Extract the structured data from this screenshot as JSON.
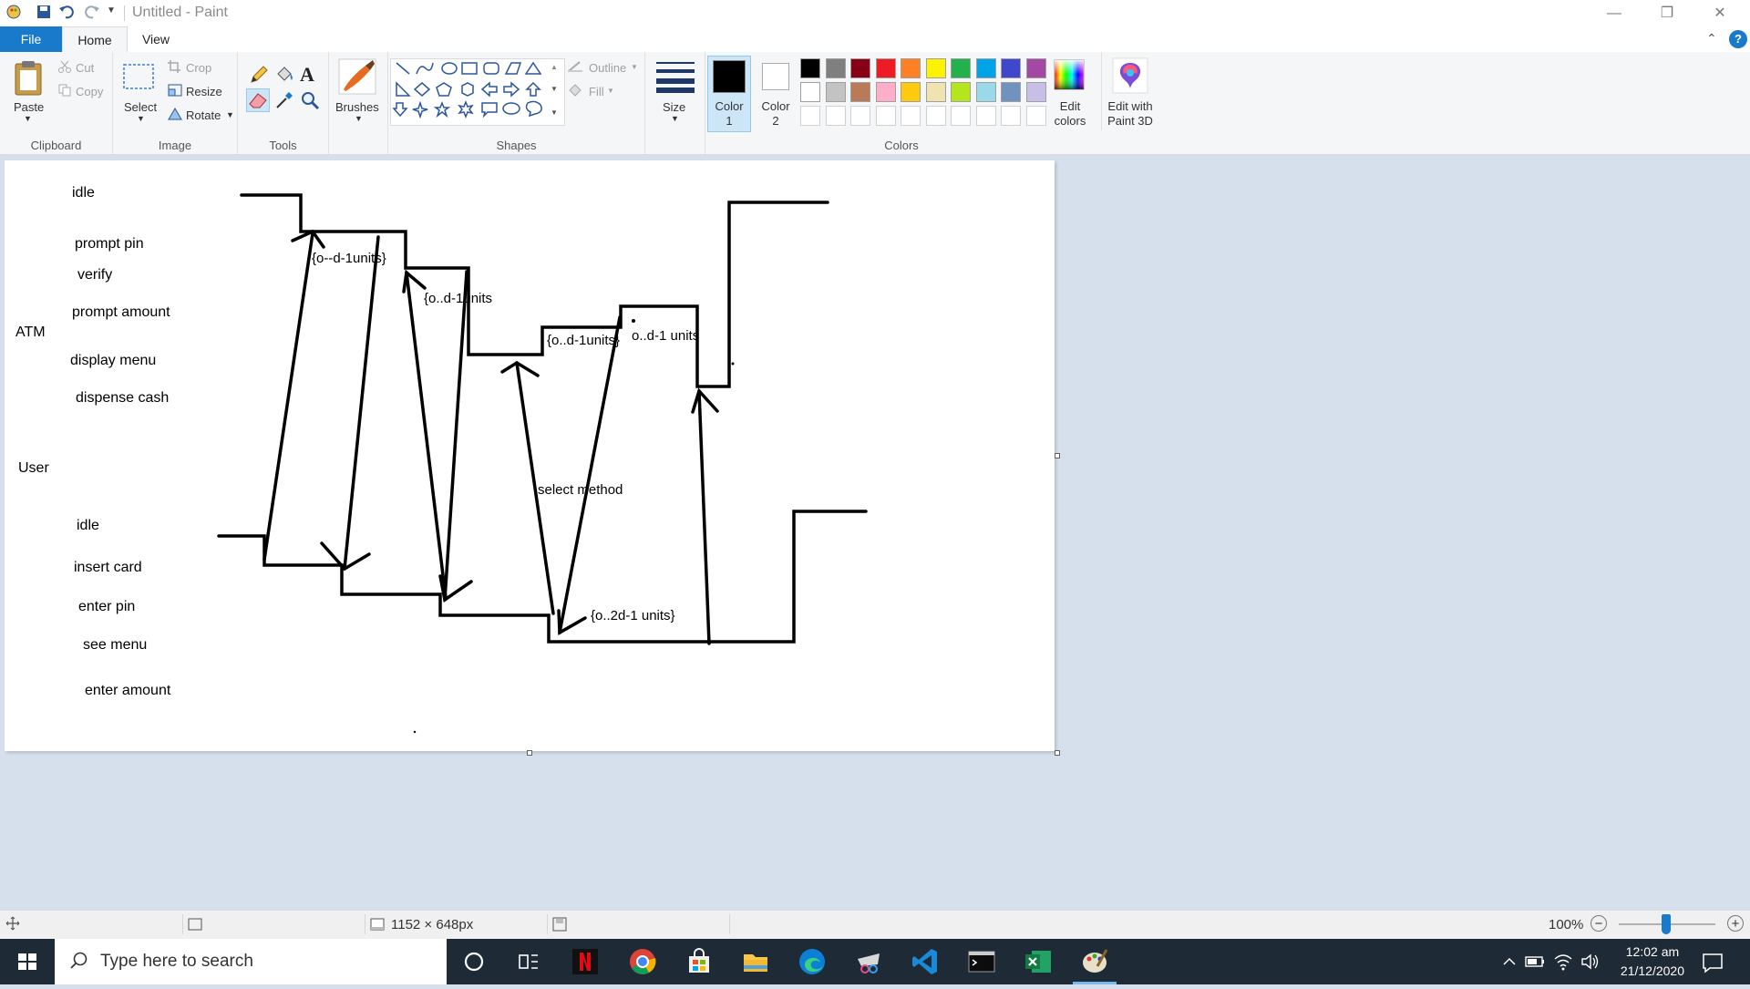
{
  "window": {
    "title": "Untitled - Paint",
    "controls": [
      "—",
      "❐",
      "✕"
    ]
  },
  "tabs": [
    {
      "label": "File"
    },
    {
      "label": "Home"
    },
    {
      "label": "View"
    }
  ],
  "ribbon": {
    "clipboard": {
      "group": "Clipboard",
      "paste": "Paste",
      "cut": "Cut",
      "copy": "Copy"
    },
    "image": {
      "group": "Image",
      "select": "Select",
      "crop": "Crop",
      "resize": "Resize",
      "rotate": "Rotate"
    },
    "tools": {
      "group": "Tools"
    },
    "brushes": {
      "label": "Brushes"
    },
    "shapes": {
      "group": "Shapes",
      "outline": "Outline",
      "fill": "Fill"
    },
    "size": {
      "label": "Size"
    },
    "colors": {
      "group": "Colors",
      "color1": "Color 1",
      "color2": "Color 2",
      "edit_colors": "Edit colors",
      "edit_3d": "Edit with Paint 3D",
      "color1_value": "#000000",
      "color2_value": "#ffffff",
      "palette_row1": [
        "#000000",
        "#7f7f7f",
        "#880015",
        "#ed1c24",
        "#ff7f27",
        "#fff200",
        "#22b14c",
        "#00a2e8",
        "#3f48cc",
        "#a349a4"
      ],
      "palette_row2": [
        "#ffffff",
        "#c3c3c3",
        "#b97a57",
        "#ffaec9",
        "#ffc90e",
        "#efe4b0",
        "#b5e61d",
        "#99d9ea",
        "#7092be",
        "#c8bfe7"
      ]
    }
  },
  "canvas": {
    "labels": {
      "atm": "ATM",
      "user": "User",
      "atm_idle": "idle",
      "prompt_pin": "prompt pin",
      "verify": "verify",
      "prompt_amount": "prompt amount",
      "display_menu": "display menu",
      "dispense_cash": "dispense cash",
      "user_idle": "idle",
      "insert_card": "insert card",
      "enter_pin": "enter pin",
      "see_menu": "see menu",
      "enter_amount": "enter amount"
    },
    "annotations": {
      "a1": "{o--d-1units}",
      "a2": "{o..d-1units",
      "a3": "{o..d-1units}",
      "a4": "o..d-1 units",
      "a5": "select method",
      "a6": "{o..2d-1 units}"
    }
  },
  "statusbar": {
    "dimensions": "1152 × 648px",
    "zoom": "100%",
    "zoom_minus": "−",
    "zoom_plus": "+"
  },
  "taskbar": {
    "search_placeholder": "Type here to search",
    "time": "12:02 am",
    "date": "21/12/2020"
  }
}
